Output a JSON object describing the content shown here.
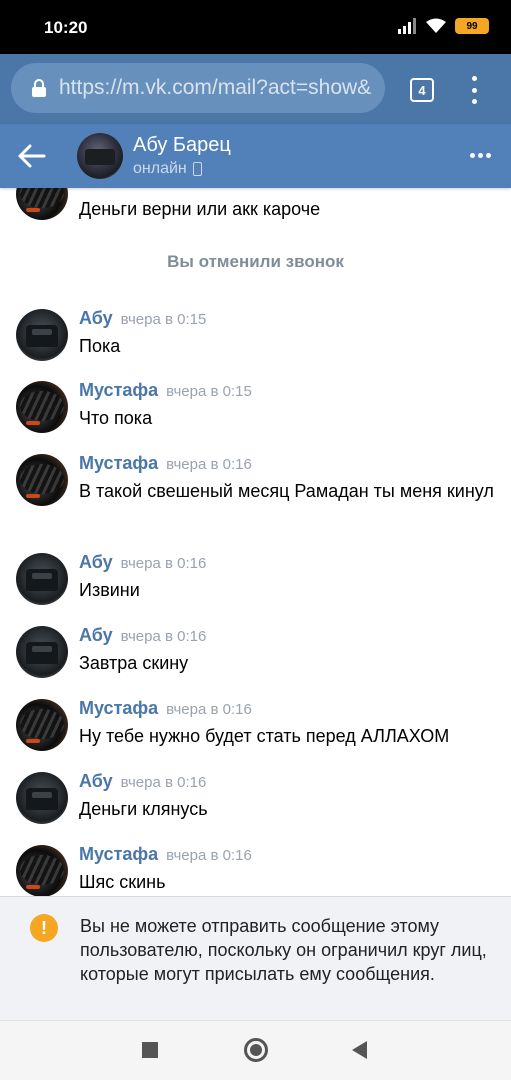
{
  "status_bar": {
    "time": "10:20",
    "battery": "99"
  },
  "browser": {
    "url": "https://m.vk.com/mail?act=show&",
    "tab_count": "4"
  },
  "header": {
    "name": "Абу Барец",
    "status": "онлайн"
  },
  "top_partial_message": "Деньги верни или акк кароче",
  "system_message": "Вы отменили звонок",
  "messages": [
    {
      "author": "Абу",
      "time": "вчера в 0:15",
      "text": "Пока",
      "avatar": "car"
    },
    {
      "author": "Мустафа",
      "time": "вчера в 0:15",
      "text": "Что пока",
      "avatar": "tire"
    },
    {
      "author": "Мустафа",
      "time": "вчера в 0:16",
      "text": "В такой свешеный месяц Рамадан ты меня кинул",
      "avatar": "tire"
    },
    {
      "author": "Абу",
      "time": "вчера в 0:16",
      "text": "Извини",
      "avatar": "car"
    },
    {
      "author": "Абу",
      "time": "вчера в 0:16",
      "text": "Завтра скину",
      "avatar": "car"
    },
    {
      "author": "Мустафа",
      "time": "вчера в 0:16",
      "text": "Ну тебе нужно будет стать перед АЛЛАХОМ",
      "avatar": "tire"
    },
    {
      "author": "Абу",
      "time": "вчера в 0:16",
      "text": "Деньги клянусь",
      "avatar": "car"
    },
    {
      "author": "Мустафа",
      "time": "вчера в 0:16",
      "text": "Шяс скинь",
      "avatar": "tire"
    }
  ],
  "notice": {
    "text": "Вы не можете отправить сообщение этому пользователю, поскольку он ограничил круг лиц, которые могут присылать ему сообщения.",
    "icon": "!"
  },
  "colors": {
    "header": "#5181b8",
    "browser": "#4a76a8",
    "author": "#4a76a8",
    "warning": "#f5a623"
  }
}
